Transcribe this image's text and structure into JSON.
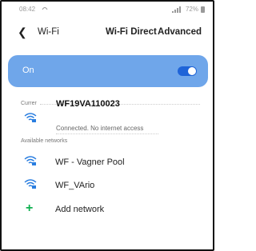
{
  "status_bar": {
    "time": "08:42",
    "left_icon": "signal-icon",
    "right_text": "72%",
    "battery_icon": "battery-icon"
  },
  "toolbar": {
    "back_icon": "back-arrow-icon",
    "title": "Wi-Fi",
    "wifi_direct_label": "Wi-Fi Direct",
    "advanced_label": "Advanced"
  },
  "toggle_bar": {
    "label": "On",
    "state": true,
    "color": "#6fa6ea"
  },
  "current": {
    "section_label": "Currer",
    "name": "WF19VA110023",
    "status": "Connected. No internet access",
    "icon": "wifi-lock-icon"
  },
  "available": {
    "section_label": "Available networks",
    "networks": [
      {
        "name": "WF - Vagner Pool",
        "icon": "wifi-lock-icon"
      },
      {
        "name": "WF_VArio",
        "icon": "wifi-lock-icon"
      }
    ]
  },
  "add_network": {
    "label": "Add network",
    "icon": "plus-icon"
  }
}
